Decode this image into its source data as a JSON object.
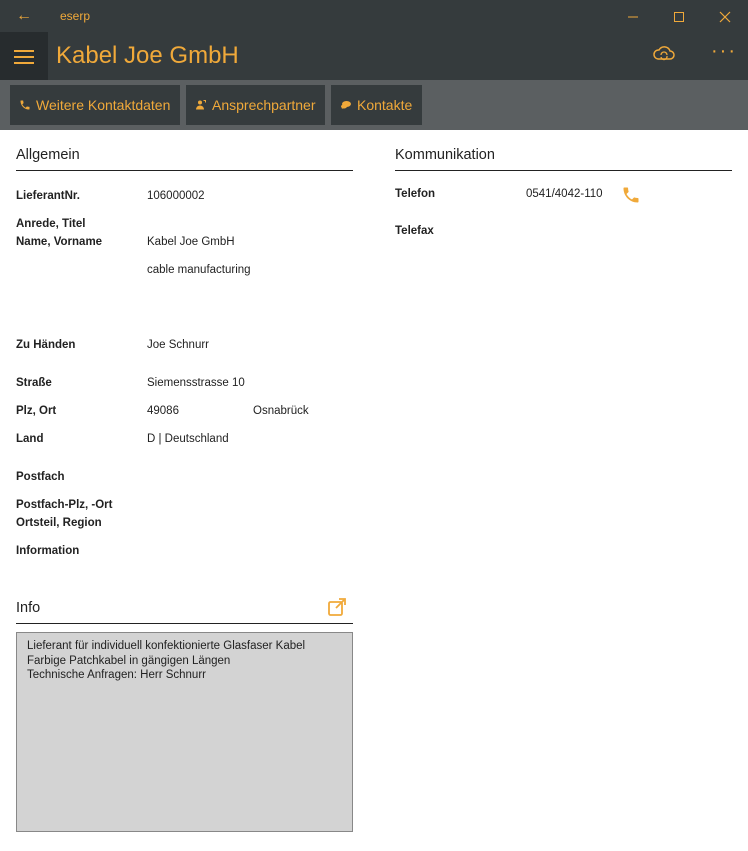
{
  "window": {
    "app_title": "eserp",
    "back_icon": "arrow-left-icon",
    "minimize_icon": "minimize-icon",
    "maximize_icon": "maximize-icon",
    "close_icon": "close-icon"
  },
  "header": {
    "title": "Kabel Joe GmbH",
    "menu_icon": "hamburger-icon",
    "sync_icon": "cloud-sync-icon",
    "more_label": "···"
  },
  "toolbar": {
    "buttons": [
      {
        "label": "Weitere Kontaktdaten",
        "icon": "phone-icon"
      },
      {
        "label": "Ansprechpartner",
        "icon": "contact-person-icon"
      },
      {
        "label": "Kontakte",
        "icon": "chat-icon"
      }
    ]
  },
  "allgemein": {
    "heading": "Allgemein",
    "lieferant_label": "LieferantNr.",
    "lieferant_value": "106000002",
    "anrede_label": "Anrede, Titel",
    "name_label": "Name, Vorname",
    "name_value": "Kabel Joe GmbH",
    "name_value2": "cable manufacturing",
    "zuhaenden_label": "Zu Händen",
    "zuhaenden_value": "Joe Schnurr",
    "strasse_label": "Straße",
    "strasse_value": "Siemensstrasse 10",
    "plzort_label": "Plz, Ort",
    "plz_value": "49086",
    "ort_value": "Osnabrück",
    "land_label": "Land",
    "land_value": "D | Deutschland",
    "postfach_label": "Postfach",
    "postfachplz_label": "Postfach-Plz, -Ort",
    "ortsteil_label": "Ortsteil, Region",
    "information_label": "Information"
  },
  "kommunikation": {
    "heading": "Kommunikation",
    "telefon_label": "Telefon",
    "telefon_value": "0541/4042-110",
    "telefax_label": "Telefax"
  },
  "info": {
    "heading": "Info",
    "edit_icon": "external-edit-icon",
    "lines": [
      "Lieferant für individuell konfektionierte Glasfaser Kabel",
      "Farbige Patchkabel in gängigen Längen",
      "Technische Anfragen: Herr Schnurr"
    ]
  },
  "colors": {
    "accent": "#f0a93a",
    "chrome": "#353b3d",
    "toolbar_bg": "#5b5f61",
    "info_bg": "#d3d3d3"
  }
}
